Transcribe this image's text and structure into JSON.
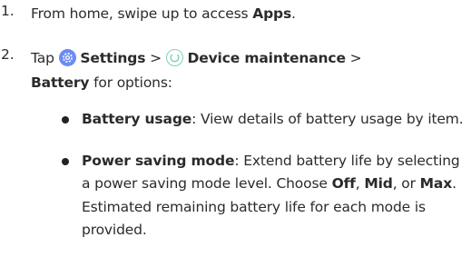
{
  "steps": [
    {
      "num": "1.",
      "pre": "From home, swipe up to access ",
      "bold": "Apps",
      "post": "."
    },
    {
      "num": "2.",
      "pre": "Tap ",
      "settings_icon": "settings-gear-icon",
      "settings_label": "Settings",
      "sep1": " > ",
      "maint_icon": "device-maintenance-icon",
      "maint_label": "Device maintenance",
      "sep2": " >",
      "battery_label": "Battery",
      "post": " for options:"
    }
  ],
  "bullets": [
    {
      "term": "Battery usage",
      "text": ": View details of battery usage by item."
    },
    {
      "term": "Power saving mode",
      "text_a": ": Extend battery life by selecting a power saving mode level. Choose ",
      "opt1": "Off",
      "comma1": ", ",
      "opt2": "Mid",
      "comma2": ", or ",
      "opt3": "Max",
      "text_b": ". Estimated remaining battery life for each mode is provided."
    }
  ],
  "colors": {
    "settings_icon_bg": "#6b8cf2",
    "maint_icon_ring": "#7fd1b2"
  }
}
